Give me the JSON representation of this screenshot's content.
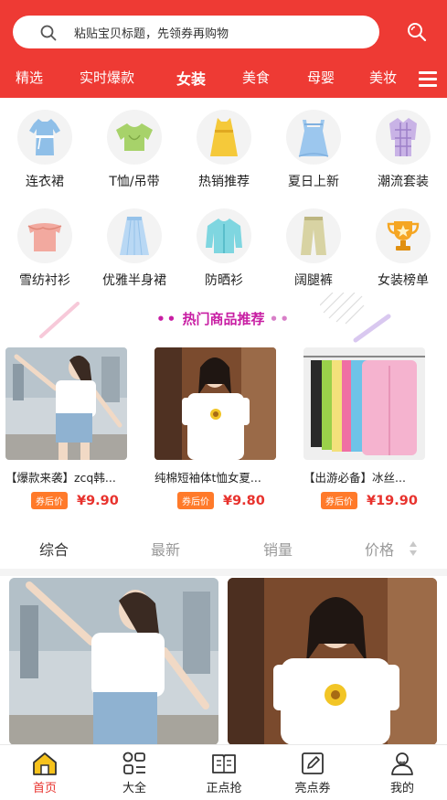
{
  "search": {
    "placeholder": "粘贴宝贝标题，先领券再购物"
  },
  "tabs": [
    {
      "label": "精选"
    },
    {
      "label": "实时爆款"
    },
    {
      "label": "女装"
    },
    {
      "label": "美食"
    },
    {
      "label": "母婴"
    },
    {
      "label": "美妆"
    }
  ],
  "active_tab": "女装",
  "categories": [
    {
      "label": "连衣裙",
      "icon": "dress-icon"
    },
    {
      "label": "T恤/吊带",
      "icon": "tshirt-icon"
    },
    {
      "label": "热销推荐",
      "icon": "hot-sale-icon"
    },
    {
      "label": "夏日上新",
      "icon": "summer-dress-icon"
    },
    {
      "label": "潮流套装",
      "icon": "plaid-set-icon"
    },
    {
      "label": "雪纺衬衫",
      "icon": "chiffon-shirt-icon"
    },
    {
      "label": "优雅半身裙",
      "icon": "skirt-icon"
    },
    {
      "label": "防晒衫",
      "icon": "sun-jacket-icon"
    },
    {
      "label": "阔腿裤",
      "icon": "wide-pants-icon"
    },
    {
      "label": "女装榜单",
      "icon": "trophy-icon"
    }
  ],
  "hot_section": {
    "title": "热门商品推荐"
  },
  "hot_products": [
    {
      "name": "【爆款来袭】zcq韩...",
      "coupon": "券后价",
      "price": "¥9.90"
    },
    {
      "name": "纯棉短袖体t恤女夏...",
      "coupon": "券后价",
      "price": "¥9.80"
    },
    {
      "name": "【出游必备】冰丝...",
      "coupon": "券后价",
      "price": "¥19.90"
    }
  ],
  "sort_options": [
    {
      "label": "综合"
    },
    {
      "label": "最新"
    },
    {
      "label": "销量"
    },
    {
      "label": "价格"
    }
  ],
  "bottom_nav": [
    {
      "label": "首页",
      "icon": "home-icon"
    },
    {
      "label": "大全",
      "icon": "category-grid-icon"
    },
    {
      "label": "正点抢",
      "icon": "book-icon"
    },
    {
      "label": "亮点券",
      "icon": "edit-icon"
    },
    {
      "label": "我的",
      "icon": "user-icon"
    }
  ],
  "colors": {
    "brand_red": "#ee3a34",
    "price_red": "#e8322d",
    "coupon_orange": "#ff7a2a",
    "section_title": "#c81ea3"
  }
}
